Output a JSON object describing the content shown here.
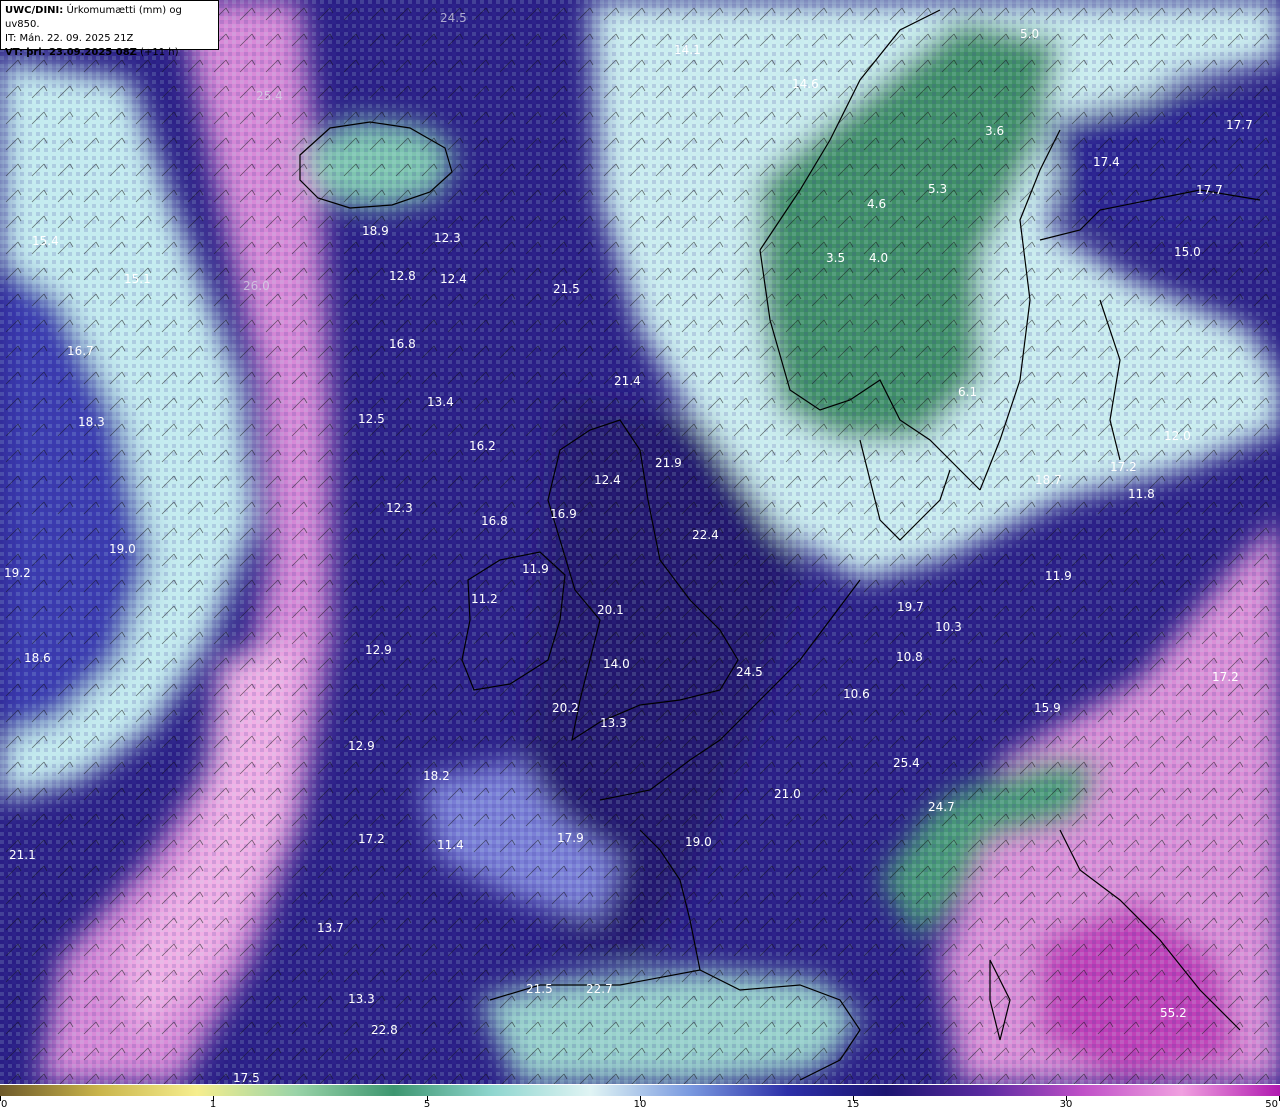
{
  "header": {
    "product": "UWC/DINI:",
    "variable": "Úrkomumætti (mm) og uv850.",
    "init_time": "IT: Mán. 22. 09. 2025 21Z",
    "valid_label": "VT:",
    "valid_time": "þri. 23.09.2025 08Z",
    "lead": "(+11 h)"
  },
  "colorbar": {
    "ticks": [
      "0",
      "1",
      "5",
      "10",
      "15",
      "30",
      "50"
    ],
    "stops": [
      "#6e5a2a",
      "#c9b44a",
      "#f6ee8e",
      "#9ad4a8",
      "#3d9670",
      "#8fd6cf",
      "#e0f4f4",
      "#7a9ae0",
      "#2c2fa8",
      "#1c1570",
      "#5a2aa0",
      "#c050c8",
      "#f0a0e0",
      "#b01ab0"
    ]
  },
  "colors": {
    "land_green": "#3d8a62",
    "moisture_light": "#c8eef0",
    "moisture_mid": "#4848c0",
    "moisture_dark": "#20186e",
    "moisture_high": "#e8a0e0",
    "coast": "#000000"
  },
  "values": [
    {
      "v": "24.5",
      "dim": true
    },
    {
      "v": "14.1"
    },
    {
      "v": "5.0"
    },
    {
      "v": "14.6"
    },
    {
      "v": "25.4",
      "dim": true
    },
    {
      "v": "3.6"
    },
    {
      "v": "17.7"
    },
    {
      "v": "17.4"
    },
    {
      "v": "17.7"
    },
    {
      "v": "5.3"
    },
    {
      "v": "4.6"
    },
    {
      "v": "18.9"
    },
    {
      "v": "12.3"
    },
    {
      "v": "15.4"
    },
    {
      "v": "15.1"
    },
    {
      "v": "12.8"
    },
    {
      "v": "12.4"
    },
    {
      "v": "3.5"
    },
    {
      "v": "4.0"
    },
    {
      "v": "15.0"
    },
    {
      "v": "26.0",
      "dim": true
    },
    {
      "v": "21.5"
    },
    {
      "v": "16.8"
    },
    {
      "v": "16.7"
    },
    {
      "v": "21.4"
    },
    {
      "v": "6.1"
    },
    {
      "v": "18.3"
    },
    {
      "v": "12.5"
    },
    {
      "v": "13.4"
    },
    {
      "v": "12.0"
    },
    {
      "v": "16.2"
    },
    {
      "v": "21.9"
    },
    {
      "v": "17.2"
    },
    {
      "v": "12.4"
    },
    {
      "v": "18.7"
    },
    {
      "v": "11.8"
    },
    {
      "v": "12.3"
    },
    {
      "v": "16.8"
    },
    {
      "v": "16.9"
    },
    {
      "v": "22.4"
    },
    {
      "v": "19.0"
    },
    {
      "v": "19.2"
    },
    {
      "v": "11.9"
    },
    {
      "v": "11.9"
    },
    {
      "v": "11.2"
    },
    {
      "v": "20.1"
    },
    {
      "v": "19.7"
    },
    {
      "v": "10.3"
    },
    {
      "v": "18.6"
    },
    {
      "v": "12.9"
    },
    {
      "v": "14.0"
    },
    {
      "v": "10.8"
    },
    {
      "v": "24.5"
    },
    {
      "v": "17.2"
    },
    {
      "v": "20.2"
    },
    {
      "v": "13.3"
    },
    {
      "v": "10.6"
    },
    {
      "v": "15.9"
    },
    {
      "v": "12.9"
    },
    {
      "v": "18.2"
    },
    {
      "v": "25.4"
    },
    {
      "v": "21.0"
    },
    {
      "v": "24.7"
    },
    {
      "v": "17.2"
    },
    {
      "v": "11.4"
    },
    {
      "v": "17.9"
    },
    {
      "v": "19.0"
    },
    {
      "v": "21.1"
    },
    {
      "v": "13.7"
    },
    {
      "v": "13.3"
    },
    {
      "v": "21.5"
    },
    {
      "v": "22.7"
    },
    {
      "v": "22.8"
    },
    {
      "v": "55.2"
    },
    {
      "v": "17.5"
    }
  ]
}
